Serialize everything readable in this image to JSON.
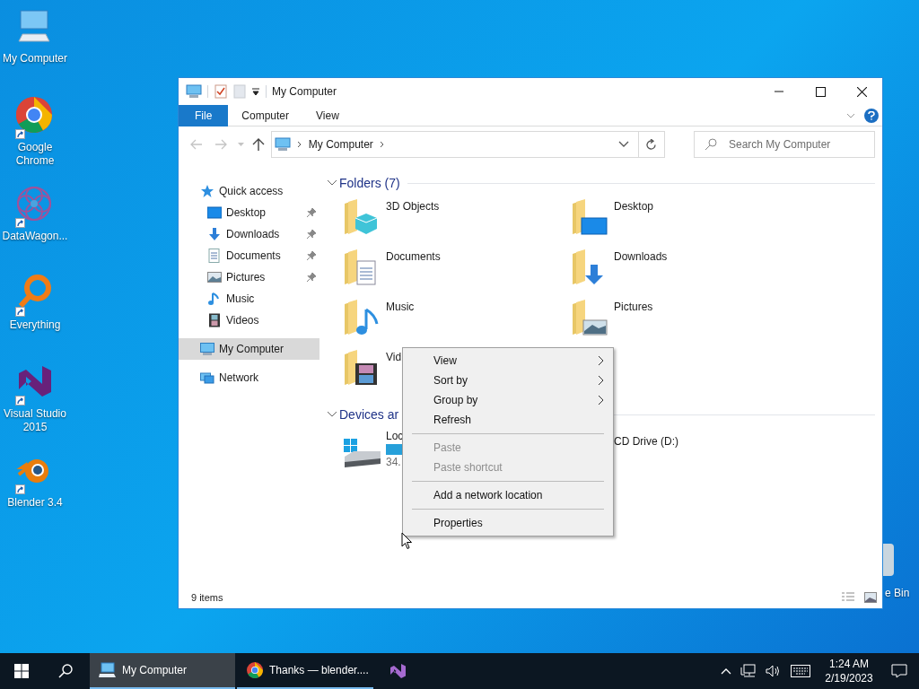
{
  "desktop": {
    "icons": [
      {
        "label": "My Computer",
        "kind": "computer",
        "shortcut": false
      },
      {
        "label": "Google Chrome",
        "kind": "chrome",
        "shortcut": true
      },
      {
        "label": "DataWagon...",
        "kind": "flower",
        "shortcut": true
      },
      {
        "label": "Everything",
        "kind": "magnifier",
        "shortcut": true
      },
      {
        "label": "Visual Studio 2015",
        "kind": "studio",
        "shortcut": true
      },
      {
        "label": "Blender 3.4",
        "kind": "blender",
        "shortcut": true
      }
    ],
    "partial_icon": {
      "label": "e Bin"
    }
  },
  "window": {
    "title": "My Computer",
    "ribbon_tabs": [
      {
        "label": "File",
        "selected": true
      },
      {
        "label": "Computer",
        "selected": false
      },
      {
        "label": "View",
        "selected": false
      }
    ],
    "address": {
      "path": "My Computer"
    },
    "search": {
      "placeholder": "Search My Computer"
    },
    "navigation": [
      {
        "label": "Quick access",
        "kind": "star",
        "selected": false,
        "children": [
          {
            "label": "Desktop",
            "kind": "desktop",
            "pinned": true,
            "selected": false
          },
          {
            "label": "Downloads",
            "kind": "download",
            "pinned": true,
            "selected": false
          },
          {
            "label": "Documents",
            "kind": "document",
            "pinned": true,
            "selected": false
          },
          {
            "label": "Pictures",
            "kind": "picture",
            "pinned": true,
            "selected": false
          },
          {
            "label": "Music",
            "kind": "music",
            "pinned": false,
            "selected": false
          },
          {
            "label": "Videos",
            "kind": "video",
            "pinned": false,
            "selected": false
          }
        ]
      },
      {
        "label": "My Computer",
        "kind": "computer",
        "selected": true
      },
      {
        "label": "Network",
        "kind": "network",
        "selected": false
      }
    ],
    "groups": [
      {
        "title": "Folders (7)",
        "expanded": true,
        "items": [
          {
            "name": "3D Objects",
            "kind": "cube"
          },
          {
            "name": "Desktop",
            "kind": "desktop"
          },
          {
            "name": "Documents",
            "kind": "document"
          },
          {
            "name": "Downloads",
            "kind": "download"
          },
          {
            "name": "Music",
            "kind": "music"
          },
          {
            "name": "Pictures",
            "kind": "picture"
          },
          {
            "name": "Vid",
            "kind": "video"
          }
        ]
      },
      {
        "title": "Devices ar",
        "expanded": true,
        "items": [
          {
            "name": "Loc",
            "detail": "34.",
            "kind": "drive"
          },
          {
            "name": "CD Drive (D:)",
            "kind": "cd"
          }
        ]
      }
    ],
    "status": "9 items"
  },
  "context_menu": [
    {
      "kind": "item",
      "label": "View",
      "submenu": true,
      "disabled": false
    },
    {
      "kind": "item",
      "label": "Sort by",
      "submenu": true,
      "disabled": false
    },
    {
      "kind": "item",
      "label": "Group by",
      "submenu": true,
      "disabled": false
    },
    {
      "kind": "item",
      "label": "Refresh",
      "submenu": false,
      "disabled": false
    },
    {
      "kind": "separator"
    },
    {
      "kind": "item",
      "label": "Paste",
      "submenu": false,
      "disabled": true
    },
    {
      "kind": "item",
      "label": "Paste shortcut",
      "submenu": false,
      "disabled": true
    },
    {
      "kind": "separator"
    },
    {
      "kind": "item",
      "label": "Add a network location",
      "submenu": false,
      "disabled": false
    },
    {
      "kind": "separator"
    },
    {
      "kind": "item",
      "label": "Properties",
      "submenu": false,
      "disabled": false
    }
  ],
  "taskbar": {
    "apps": [
      {
        "label": "My Computer",
        "kind": "explorer",
        "selected": true
      },
      {
        "label": "Thanks — blender....",
        "kind": "chrome",
        "selected": false
      },
      {
        "kind": "studio",
        "selected": false
      }
    ],
    "time": "1:24 AM",
    "date": "2/19/2023"
  }
}
